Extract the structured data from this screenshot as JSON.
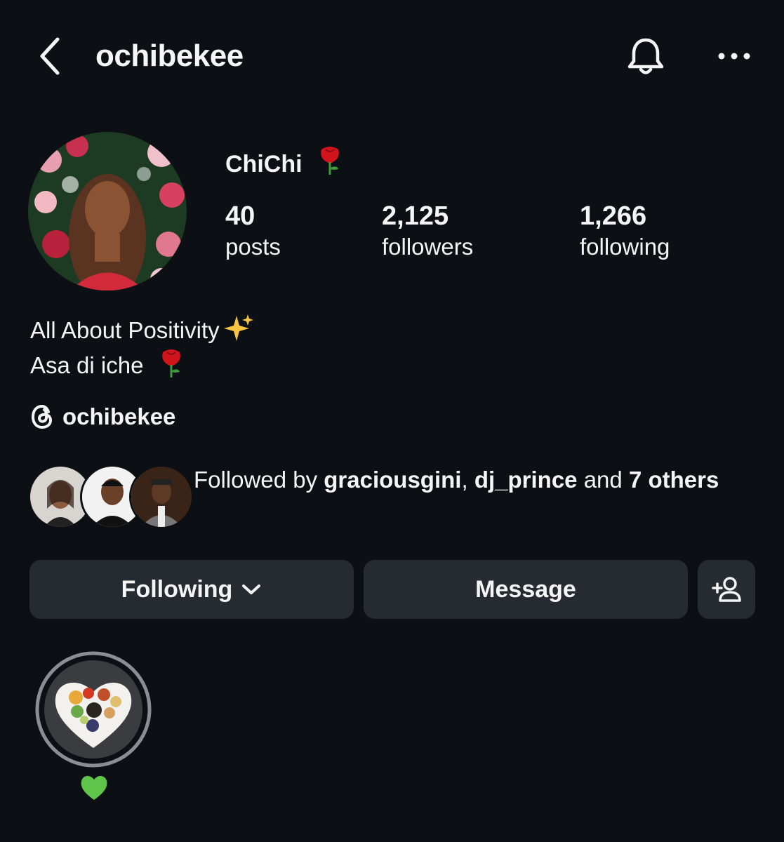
{
  "header": {
    "username": "ochibekee",
    "icons": [
      "back-icon",
      "bell-icon",
      "more-icon"
    ]
  },
  "profile": {
    "display_name": "ChiChi",
    "name_emoji": "rose",
    "stats": [
      {
        "value": "40",
        "label": "posts"
      },
      {
        "value": "2,125",
        "label": "followers"
      },
      {
        "value": "1,266",
        "label": "following"
      }
    ],
    "bio": {
      "line1": "All About Positivity",
      "line1_emoji": "sparkles",
      "line2": "Asa di iche",
      "line2_emoji": "rose"
    },
    "threads_handle": "ochibekee"
  },
  "followed_by": {
    "prefix": "Followed by ",
    "user1": "graciousgini",
    "separator": ", ",
    "user2": "dj_prince",
    "middle": " and ",
    "others": "7 others"
  },
  "actions": {
    "following_label": "Following",
    "message_label": "Message"
  },
  "highlights": [
    {
      "label_emoji": "green-heart"
    }
  ],
  "colors": {
    "background": "#0c0f14",
    "button_bg": "#262a31",
    "text": "#f5f5f5",
    "rose": "#d2141c",
    "green_heart": "#5ec44a"
  }
}
